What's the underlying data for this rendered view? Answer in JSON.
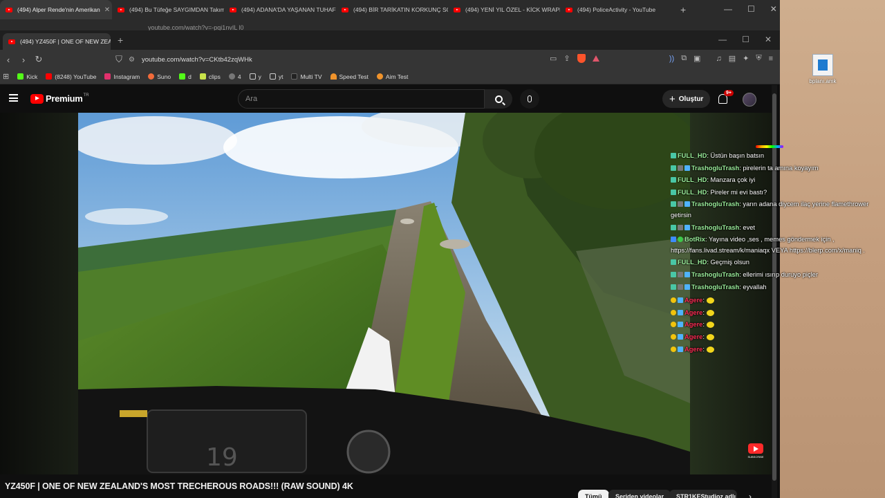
{
  "back_window": {
    "tabs": [
      {
        "title": "(494) Alper Rende'nin Amerikan"
      },
      {
        "title": "(494) Bu Tüfeğe SAYGIMDAN Takım"
      },
      {
        "title": "(494) ADANA'DA YAŞANAN TUHAF O"
      },
      {
        "title": "(494) BİR TARİKATIN KORKUNÇ SONU"
      },
      {
        "title": "(494) YENİ YIL ÖZEL - KİCK WRAPPED"
      },
      {
        "title": "(494) PoliceActivity - YouTube"
      }
    ],
    "url": "youtube.com/watch?v=-pqi1nvIL l0"
  },
  "front_window": {
    "tab_title": "(494) YZ450F | ONE OF NEW ZEALAND",
    "url": "youtube.com/watch?v=CKtb42zqWHk"
  },
  "bookmarks": [
    {
      "label": "Kick",
      "color": "#53fc18"
    },
    {
      "label": "(8248) YouTube",
      "color": "#ff0000"
    },
    {
      "label": "Instagram",
      "color": "#e1306c"
    },
    {
      "label": "Suno",
      "color": "#f26b3a"
    },
    {
      "label": "d",
      "color": "#53fc18"
    },
    {
      "label": "clips",
      "color": "#c8e34a"
    },
    {
      "label": "4",
      "color": "#aaaaaa"
    },
    {
      "label": "y",
      "color": "#cccccc"
    },
    {
      "label": "yt",
      "color": "#cccccc"
    },
    {
      "label": "Multi TV",
      "color": "#333333"
    },
    {
      "label": "Speed Test",
      "color": "#f0932b"
    },
    {
      "label": "Aim Test",
      "color": "#f0932b"
    }
  ],
  "youtube": {
    "logo_text": "Premium",
    "region": "TR",
    "search_placeholder": "Ara",
    "create_label": "Oluştur",
    "notification_count": "9+"
  },
  "chat": [
    {
      "user": "FULL_HD",
      "sep": ":",
      "text": "Üstün başın batsın"
    },
    {
      "user": "TrashogluTrash",
      "sep": ":",
      "text": "pirelerin ta amına koyayım"
    },
    {
      "user": "FULL_HD",
      "sep": ":",
      "text": "Manzara çok iyi"
    },
    {
      "user": "FULL_HD",
      "sep": ":",
      "text": "Pireler mi evi bastı?"
    },
    {
      "user": "TrashogluTrash",
      "sep": ":",
      "text": "yarın adana diycem ilaç yerine flamethrower getirsin"
    },
    {
      "user": "TrashogluTrash",
      "sep": ":",
      "text": "evet"
    },
    {
      "user": "BotRix",
      "sep": ":",
      "text": "Yayına video ,ses , memes göndermek için , https://fans.livad.stream/k/maniaqx VEYA https://blerp.com/x/maniq ."
    },
    {
      "user": "FULL_HD",
      "sep": ":",
      "text": "Geçmiş olsun"
    },
    {
      "user": "TrashogluTrash",
      "sep": ":",
      "text": "ellerimi ısırıp duruyo piçler"
    },
    {
      "user": "TrashogluTrash",
      "sep": ":",
      "text": "eyvallah"
    },
    {
      "user": "Agere",
      "sep": ":",
      "text": ""
    },
    {
      "user": "Agere",
      "sep": ":",
      "text": ""
    },
    {
      "user": "Agere",
      "sep": ":",
      "text": ""
    },
    {
      "user": "Agere",
      "sep": ":",
      "text": ""
    },
    {
      "user": "Agere",
      "sep": ":",
      "text": ""
    }
  ],
  "video": {
    "title": "YZ450F | ONE OF NEW ZEALAND'S MOST TRECHEROUS ROADS!!! (RAW SOUND) 4K",
    "subscribe_label": "SUBSCRIBE"
  },
  "chips": [
    "Tümü",
    "Seriden videolar",
    "STR1KEStudioz adlı"
  ],
  "desktop": {
    "icon_label": "bplanı.amk"
  }
}
